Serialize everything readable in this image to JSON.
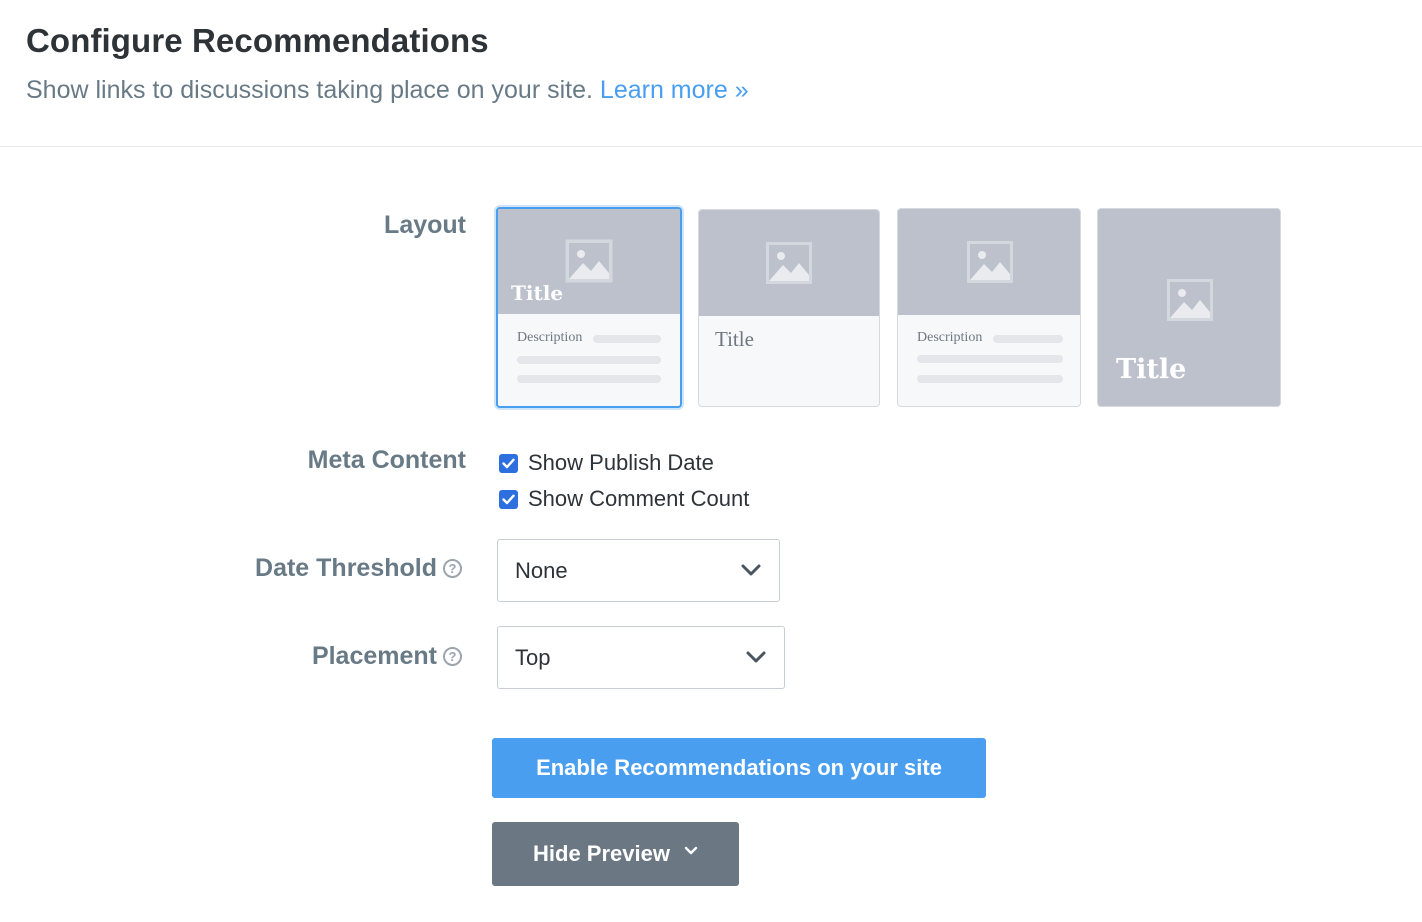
{
  "header": {
    "title": "Configure Recommendations",
    "subtitle": "Show links to discussions taking place on your site.",
    "learn_more": "Learn more »"
  },
  "layout": {
    "label": "Layout",
    "options": [
      {
        "overlay_title": "Title",
        "description": "Description",
        "selected": true
      },
      {
        "title": "Title",
        "selected": false
      },
      {
        "description": "Description",
        "selected": false
      },
      {
        "overlay_title": "Title",
        "selected": false
      }
    ]
  },
  "meta_content": {
    "label": "Meta Content",
    "options": [
      {
        "label": "Show Publish Date",
        "checked": true
      },
      {
        "label": "Show Comment Count",
        "checked": true
      }
    ]
  },
  "date_threshold": {
    "label": "Date Threshold",
    "help": "?",
    "value": "None"
  },
  "placement": {
    "label": "Placement",
    "help": "?",
    "value": "Top"
  },
  "actions": {
    "enable_label": "Enable Recommendations on your site",
    "preview_label": "Hide Preview"
  },
  "colors": {
    "accent": "#4a9ef0",
    "checkbox": "#2d6fde",
    "secondary_button": "#6b7883",
    "thumbnail": "#bcc1cc"
  },
  "icons": [
    "image-icon",
    "help-icon",
    "chevron-down-icon",
    "checkmark-icon"
  ]
}
